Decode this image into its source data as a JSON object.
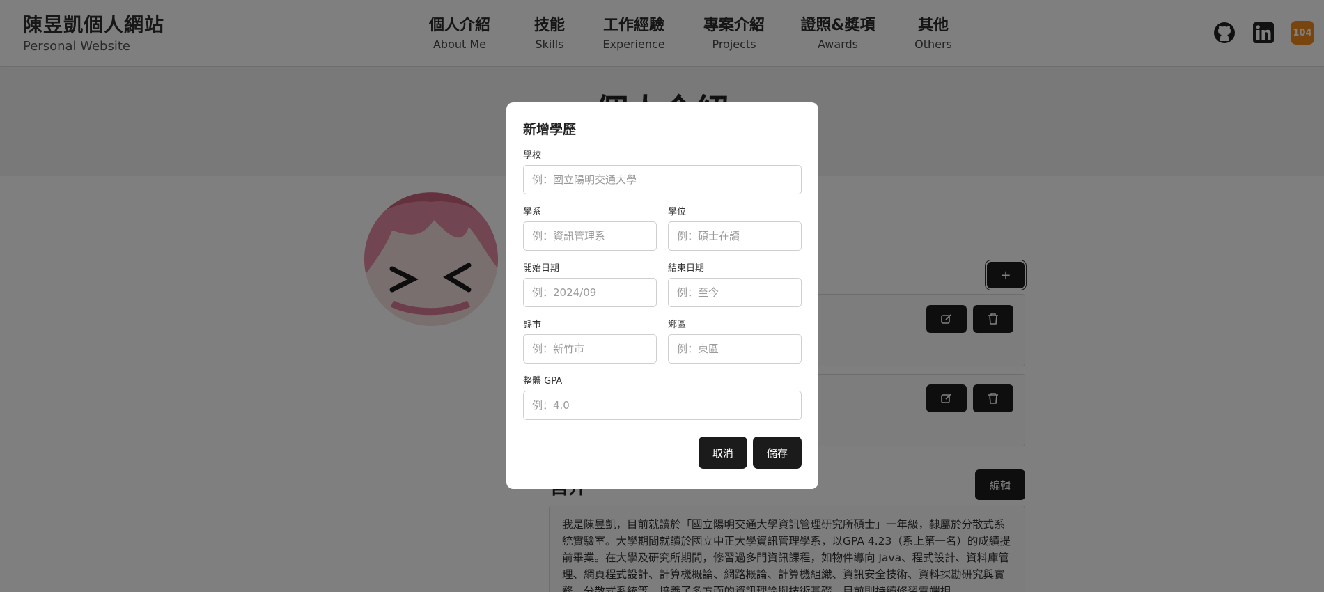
{
  "header": {
    "brand_title": "陳昱凱個人網站",
    "brand_subtitle": "Personal Website",
    "nav": [
      {
        "zh": "個人介紹",
        "en": "About Me"
      },
      {
        "zh": "技能",
        "en": "Skills"
      },
      {
        "zh": "工作經驗",
        "en": "Experience"
      },
      {
        "zh": "專案介紹",
        "en": "Projects"
      },
      {
        "zh": "證照&獎項",
        "en": "Awards"
      },
      {
        "zh": "其他",
        "en": "Others"
      }
    ],
    "socials": [
      "github-icon",
      "linkedin-icon",
      "104-icon"
    ],
    "badge_104": "104"
  },
  "page": {
    "title": "個人介紹",
    "add_button_label": "+",
    "section_heading": "自介",
    "edit_button_label": "編輯",
    "bio_text": "我是陳昱凱，目前就讀於「國立陽明交通大學資訊管理研究所碩士」一年級，隸屬於分散式系統實驗室。大學期間就讀於國立中正大學資訊管理學系，以GPA 4.23（系上第一名）的成績提前畢業。在大學及研究所期間，修習過多門資訊課程，如物件導向 Java、程式設計、資料庫管理、網頁程式設計、計算機概論、網路概論、計算機組織、資訊安全技術、資料探勘研究與實務、分散式系統等，培養了多方面的資訊理論與技術基礎，目前則持續修習雲端相"
  },
  "modal": {
    "title": "新增學歷",
    "fields": {
      "school": {
        "label": "學校",
        "placeholder": "例：國立陽明交通大學"
      },
      "department": {
        "label": "學系",
        "placeholder": "例：資訊管理系"
      },
      "degree": {
        "label": "學位",
        "placeholder": "例：碩士在讀"
      },
      "start_date": {
        "label": "開始日期",
        "placeholder": "例：2024/09"
      },
      "end_date": {
        "label": "結束日期",
        "placeholder": "例：至今"
      },
      "city": {
        "label": "縣市",
        "placeholder": "例：新竹市"
      },
      "district": {
        "label": "鄉區",
        "placeholder": "例：東區"
      },
      "gpa": {
        "label": "整體 GPA",
        "placeholder": "例：4.0"
      }
    },
    "cancel_label": "取消",
    "save_label": "儲存"
  },
  "colors": {
    "button_dark": "#1b1b1b",
    "overlay": "rgba(0,0,0,0.5)",
    "badge_104": "#f08a1c"
  }
}
